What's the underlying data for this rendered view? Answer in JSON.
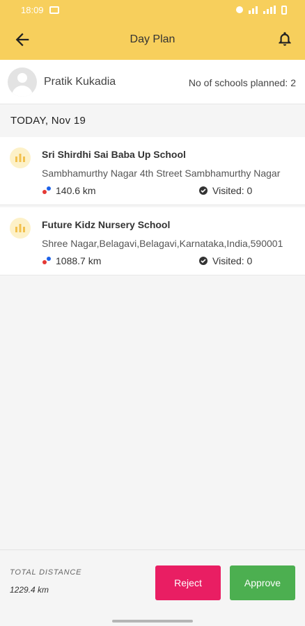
{
  "status_bar": {
    "time": "18:09"
  },
  "header": {
    "title": "Day Plan"
  },
  "user": {
    "name": "Pratik Kukadia",
    "planned_label": "No of schools planned: 2"
  },
  "date_header": "TODAY, Nov 19",
  "schools": [
    {
      "name": "Sri Shirdhi Sai Baba Up School",
      "address": "Sambhamurthy Nagar 4th Street Sambhamurthy Nagar",
      "distance": "140.6 km",
      "visited": "Visited: 0"
    },
    {
      "name": "Future Kidz Nursery School",
      "address": "Shree Nagar,Belagavi,Belagavi,Karnataka,India,590001",
      "distance": "1088.7 km",
      "visited": "Visited: 0"
    }
  ],
  "footer": {
    "total_label": "TOTAL DISTANCE",
    "total_value": "1229.4 km",
    "reject_label": "Reject",
    "approve_label": "Approve"
  },
  "colors": {
    "accent": "#f7cf5c",
    "reject": "#e91e63",
    "approve": "#4caf50"
  }
}
